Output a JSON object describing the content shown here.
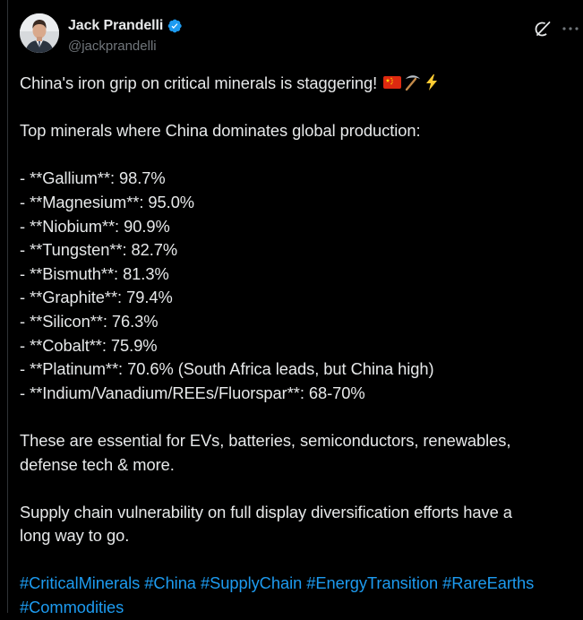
{
  "author": {
    "display_name": "Jack Prandelli",
    "handle": "@jackprandelli",
    "verified": true,
    "avatar_icon": "user-avatar-photo"
  },
  "actions": {
    "grok_icon": "grok-explain-icon",
    "more_icon": "more-options-icon"
  },
  "post": {
    "headline": "China's iron grip on critical minerals is staggering!",
    "headline_emojis": [
      "china-flag-emoji",
      "pickaxe-emoji",
      "lightning-emoji"
    ],
    "intro": "Top minerals where China dominates global production:",
    "minerals": [
      "- **Gallium**: 98.7%",
      "- **Magnesium**: 95.0%",
      "- **Niobium**: 90.9%",
      "- **Tungsten**: 82.7%",
      "- **Bismuth**: 81.3%",
      "- **Graphite**: 79.4%",
      "- **Silicon**: 76.3%",
      "- **Cobalt**: 75.9%",
      "- **Platinum**: 70.6% (South Africa leads, but China high)",
      "- **Indium/Vanadium/REEs/Fluorspar**: 68-70%"
    ],
    "paragraph_1_line_1": "These are essential for EVs, batteries, semiconductors, renewables,",
    "paragraph_1_line_2": "defense tech & more.",
    "paragraph_2_line_1": "Supply chain vulnerability on full display diversification efforts have a",
    "paragraph_2_line_2": "long way to go.",
    "hashtags": [
      "#CriticalMinerals",
      "#China",
      "#SupplyChain",
      "#EnergyTransition",
      "#RareEarths",
      "#Commodities"
    ]
  },
  "colors": {
    "background": "#000000",
    "text": "#e7e9ea",
    "secondary": "#71767b",
    "link": "#1d9bf0",
    "verified": "#1d9bf0"
  }
}
